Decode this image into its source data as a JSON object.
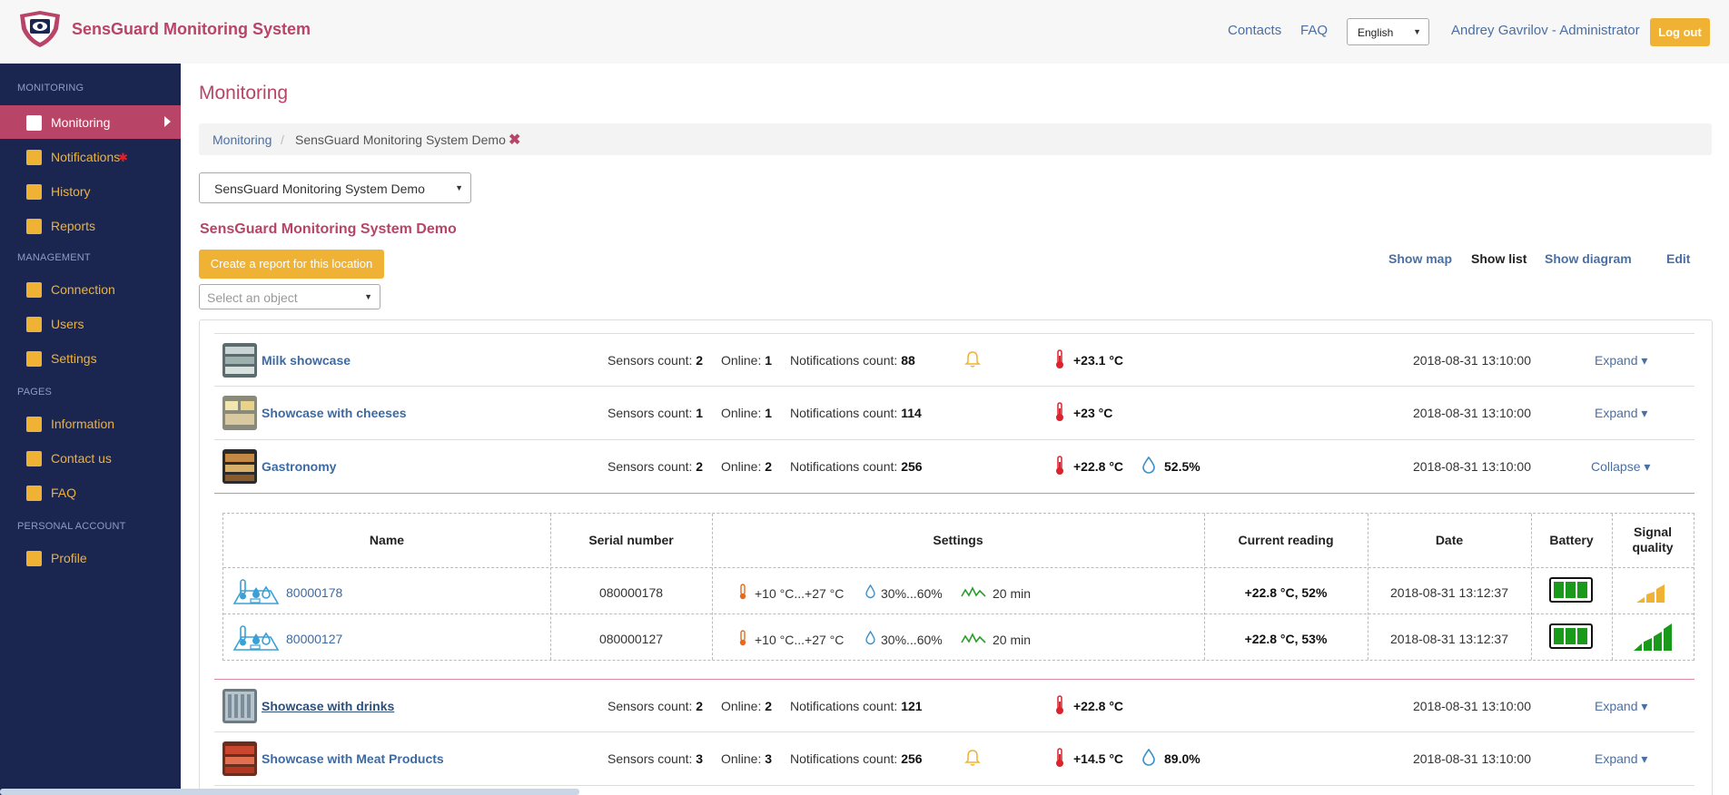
{
  "header": {
    "brand": "SensGuard Monitoring System",
    "contacts": "Contacts",
    "faq": "FAQ",
    "language": "English",
    "user": "Andrey Gavrilov - Administrator",
    "logout": "Log out"
  },
  "sidebar": {
    "sections": [
      "MONITORING",
      "MANAGEMENT",
      "PAGES",
      "PERSONAL ACCOUNT"
    ],
    "items": [
      {
        "label": "Monitoring"
      },
      {
        "label": "Notifications"
      },
      {
        "label": "History"
      },
      {
        "label": "Reports"
      },
      {
        "label": "Connection"
      },
      {
        "label": "Users"
      },
      {
        "label": "Settings"
      },
      {
        "label": "Information"
      },
      {
        "label": "Contact us"
      },
      {
        "label": "FAQ"
      },
      {
        "label": "Profile"
      }
    ],
    "notification_mark": "✱"
  },
  "main": {
    "title": "Monitoring",
    "breadcrumb": [
      "Monitoring",
      "/",
      "SensGuard Monitoring System Demo"
    ],
    "breadcrumb_close": "✖",
    "location_select": "SensGuard Monitoring System Demo",
    "location_title": "SensGuard Monitoring System Demo",
    "report_button": "Create a report for this location",
    "object_select_placeholder": "Select an object",
    "views": [
      "Show map",
      "Show list",
      "Show diagram",
      "Edit"
    ],
    "labels": {
      "sensors_count": "Sensors count:",
      "online": "Online:",
      "notifications_count": "Notifications count:"
    }
  },
  "objects": [
    {
      "name": "Milk showcase",
      "sensors": "2",
      "online": "1",
      "notifications": "88",
      "bell": true,
      "temp": "+23.1 °C",
      "humidity": "",
      "date": "2018-08-31 13:10:00",
      "action": "Expand ▾"
    },
    {
      "name": "Showcase with cheeses",
      "sensors": "1",
      "online": "1",
      "notifications": "114",
      "bell": false,
      "temp": "+23 °C",
      "humidity": "",
      "date": "2018-08-31 13:10:00",
      "action": "Expand ▾"
    },
    {
      "name": "Gastronomy",
      "sensors": "2",
      "online": "2",
      "notifications": "256",
      "bell": false,
      "temp": "+22.8 °C",
      "humidity": "52.5%",
      "date": "2018-08-31 13:10:00",
      "action": "Collapse ▾"
    },
    {
      "name": "Showcase with drinks",
      "sensors": "2",
      "online": "2",
      "notifications": "121",
      "bell": false,
      "temp": "+22.8 °C",
      "humidity": "",
      "date": "2018-08-31 13:10:00",
      "action": "Expand ▾"
    },
    {
      "name": "Showcase with Meat Products",
      "sensors": "3",
      "online": "3",
      "notifications": "256",
      "bell": true,
      "temp": "+14.5 °C",
      "humidity": "89.0%",
      "date": "2018-08-31 13:10:00",
      "action": "Expand ▾"
    }
  ],
  "sensor_table": {
    "headers": [
      "Name",
      "Serial number",
      "Settings",
      "Current reading",
      "Date",
      "Battery",
      "Signal quality"
    ],
    "rows": [
      {
        "name": "80000178",
        "serial": "080000178",
        "temp_range": "+10 °C...+27 °C",
        "hum_range": "30%...60%",
        "interval": "20 min",
        "reading": "+22.8 °C, 52%",
        "date": "2018-08-31 13:12:37",
        "battery": 3,
        "signal": 2
      },
      {
        "name": "80000127",
        "serial": "080000127",
        "temp_range": "+10 °C...+27 °C",
        "hum_range": "30%...60%",
        "interval": "20 min",
        "reading": "+22.8 °C, 53%",
        "date": "2018-08-31 13:12:37",
        "battery": 3,
        "signal": 4
      }
    ]
  },
  "colors": {
    "brand": "#b84467",
    "accent": "#f0b234",
    "sidebar": "#1b2650",
    "link": "#4a6fa5",
    "signal_weak": "#f0b234",
    "signal_strong": "#1a9a1a"
  }
}
